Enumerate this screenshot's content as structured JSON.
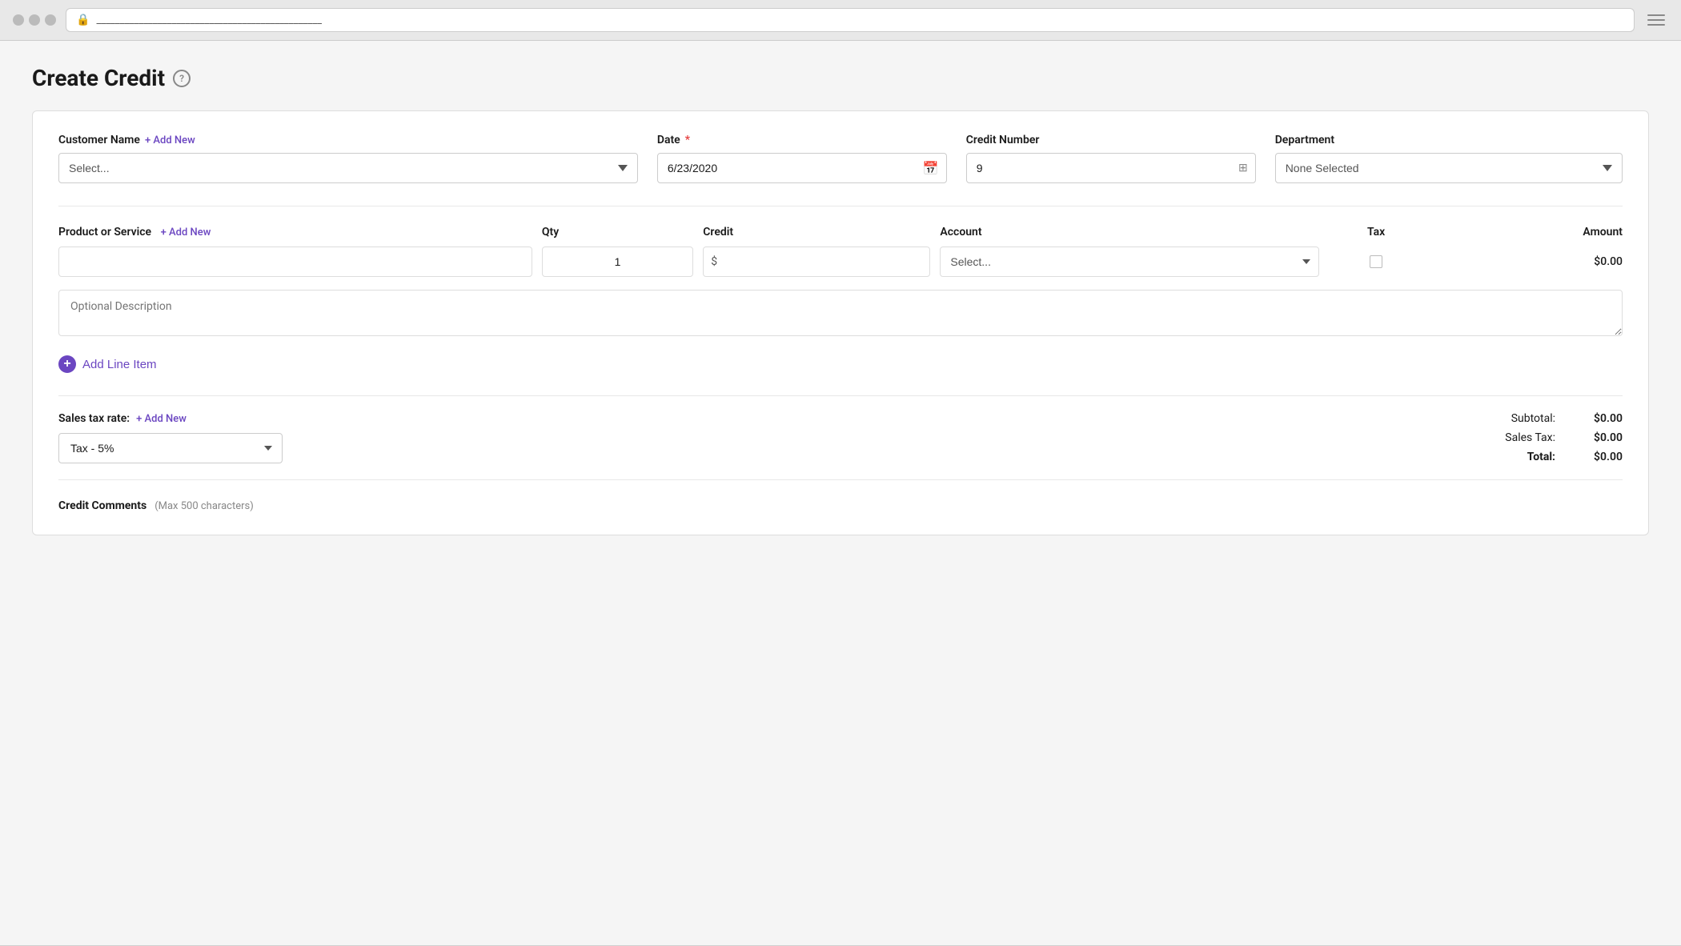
{
  "browser": {
    "address": "________________________________________________",
    "lock_icon": "🔒"
  },
  "page": {
    "title": "Create Credit",
    "help_icon": "?",
    "form": {
      "customer_name": {
        "label": "Customer Name",
        "add_new": "+ Add New",
        "placeholder": "Select...",
        "options": [
          "Select..."
        ]
      },
      "date": {
        "label": "Date",
        "required": "*",
        "value": "6/23/2020",
        "calendar_icon": "📅"
      },
      "credit_number": {
        "label": "Credit Number",
        "value": "9",
        "icon": "⊞"
      },
      "department": {
        "label": "Department",
        "value": "None Selected",
        "options": [
          "None Selected"
        ]
      },
      "line_items": {
        "product_service_label": "Product or Service",
        "add_new": "+ Add New",
        "qty_label": "Qty",
        "credit_label": "Credit",
        "account_label": "Account",
        "tax_label": "Tax",
        "amount_label": "Amount",
        "row": {
          "qty": "1",
          "credit_prefix": "$",
          "credit_value": "",
          "account_placeholder": "Select...",
          "amount": "$0.00"
        }
      },
      "optional_description": {
        "placeholder": "Optional Description"
      },
      "add_line_item": {
        "label": "Add Line Item",
        "icon": "+"
      },
      "sales_tax": {
        "label": "Sales tax rate:",
        "add_new": "+ Add New",
        "value": "Tax - 5%",
        "options": [
          "Tax - 5%"
        ]
      },
      "totals": {
        "subtotal_label": "Subtotal:",
        "subtotal_value": "$0.00",
        "sales_tax_label": "Sales Tax:",
        "sales_tax_value": "$0.00",
        "total_label": "Total:",
        "total_value": "$0.00"
      },
      "credit_comments": {
        "label": "Credit Comments",
        "max_chars": "(Max 500 characters)"
      }
    }
  }
}
